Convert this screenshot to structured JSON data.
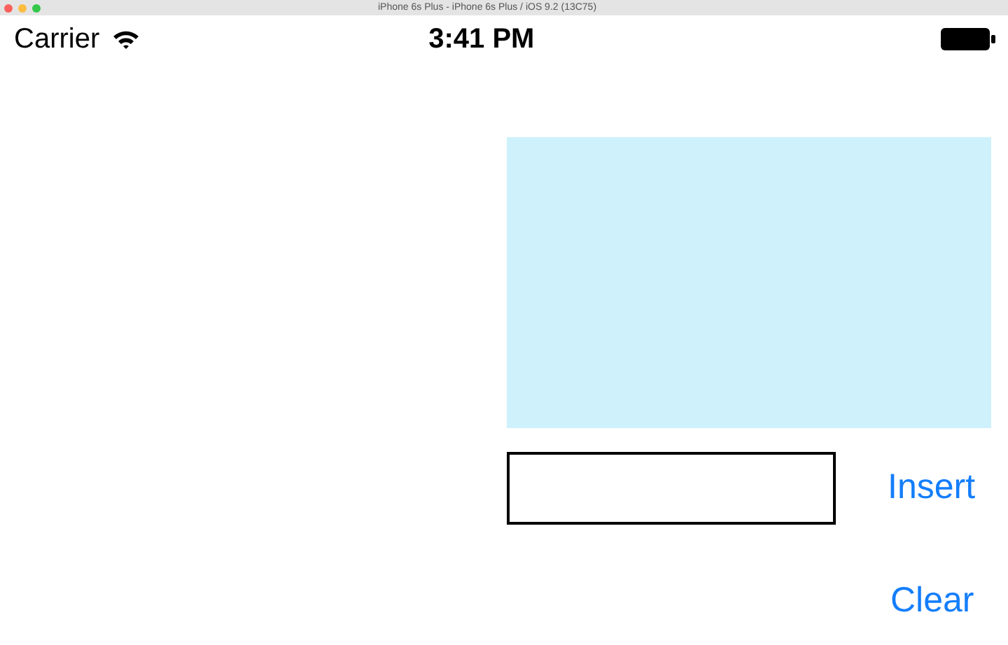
{
  "window": {
    "title": "iPhone 6s Plus - iPhone 6s Plus / iOS 9.2 (13C75)"
  },
  "status_bar": {
    "carrier": "Carrier",
    "time": "3:41 PM"
  },
  "buttons": [
    {
      "label": "Insert"
    },
    {
      "label": "Clear"
    }
  ]
}
